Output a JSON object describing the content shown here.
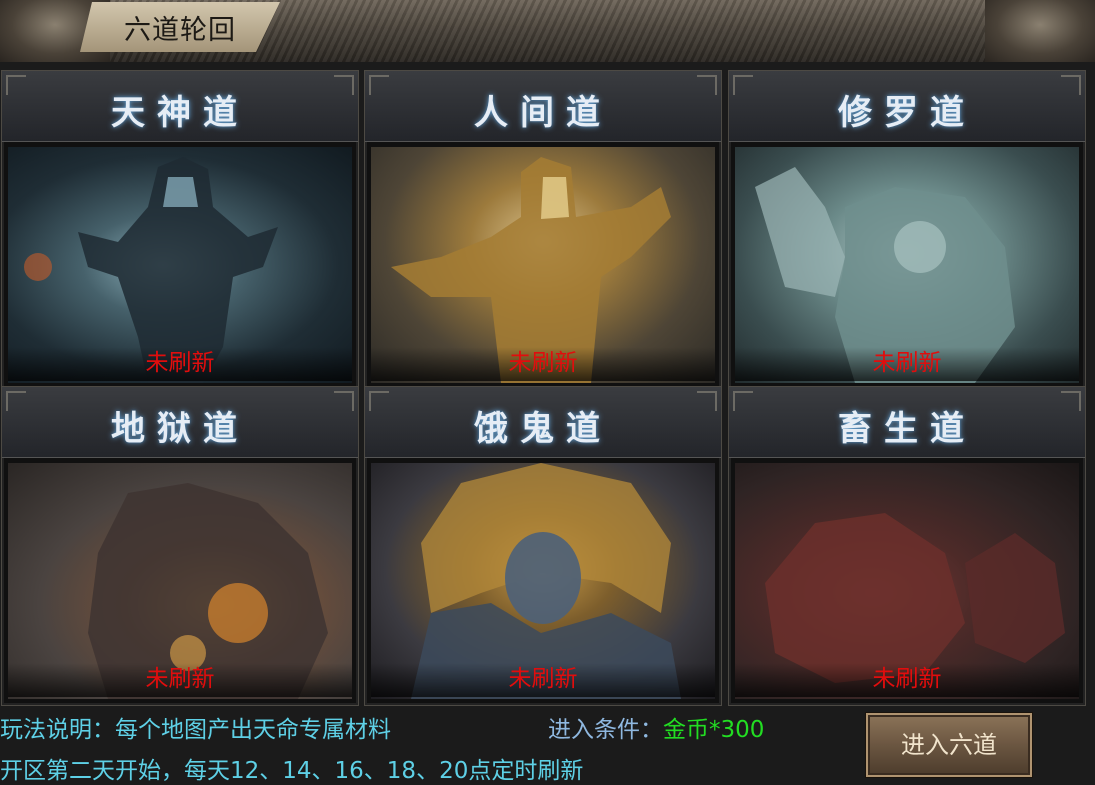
{
  "window": {
    "title": "六道轮回"
  },
  "paths": [
    {
      "name": "天神道",
      "status": "未刷新",
      "art_icon": "armored-demon-king-art"
    },
    {
      "name": "人间道",
      "status": "未刷新",
      "art_icon": "golden-warrior-art"
    },
    {
      "name": "修罗道",
      "status": "未刷新",
      "art_icon": "stone-giant-art"
    },
    {
      "name": "地狱道",
      "status": "未刷新",
      "art_icon": "flame-demon-art"
    },
    {
      "name": "饿鬼道",
      "status": "未刷新",
      "art_icon": "lion-maned-ghost-art"
    },
    {
      "name": "畜生道",
      "status": "未刷新",
      "art_icon": "crimson-beast-art"
    }
  ],
  "info": {
    "rules_label": "玩法说明：每个地图产出天命专属材料",
    "schedule": "开区第二天开始，每天12、14、16、18、20点定时刷新",
    "condition_label": "进入条件：",
    "condition_value": "金币*300"
  },
  "actions": {
    "enter_label": "进入六道"
  },
  "colors": {
    "status_red": "#e10d0d",
    "info_cyan": "#5ed0e6",
    "condition_green": "#22dd22",
    "title_glow": "#6aa7d8"
  }
}
